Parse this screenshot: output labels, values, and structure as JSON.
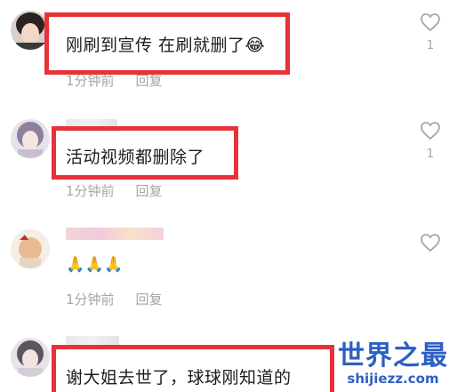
{
  "comments": [
    {
      "text": "刚刷到宣传 在刷就删了😂",
      "time": "1分钟前",
      "reply": "回复",
      "likes": "1"
    },
    {
      "text": "活动视频都删除了",
      "time": "1分钟前",
      "reply": "回复",
      "likes": "1"
    },
    {
      "text": "🙏🙏🙏",
      "time": "1分钟前",
      "reply": "回复",
      "likes": ""
    },
    {
      "text": "谢大姐去世了，球球刚知道的",
      "time": "",
      "reply": "",
      "likes": ""
    }
  ],
  "watermark": {
    "title": "世界之最",
    "url": "shijiezz.com"
  },
  "colors": {
    "highlight_box": "#e8313a",
    "meta_text": "#a6a6a6",
    "watermark": "#2d5fc4"
  }
}
